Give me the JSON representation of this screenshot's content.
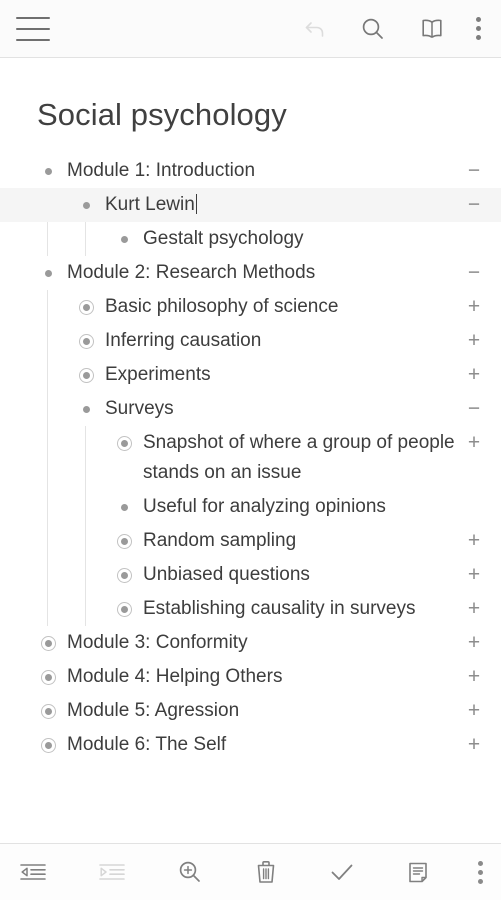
{
  "header": {
    "menu_icon": "hamburger-icon",
    "actions": [
      {
        "name": "undo",
        "icon": "undo-icon",
        "state": "disabled"
      },
      {
        "name": "search",
        "icon": "search-icon",
        "state": "enabled"
      },
      {
        "name": "book",
        "icon": "book-icon",
        "state": "enabled"
      },
      {
        "name": "more",
        "icon": "more-vertical-icon",
        "state": "enabled"
      }
    ]
  },
  "document": {
    "title": "Social psychology"
  },
  "outline": {
    "items": [
      {
        "text": "Module 1: Introduction",
        "level": 0,
        "bullet": "dot",
        "toggle": "−",
        "selected": false,
        "cursor": false
      },
      {
        "text": "Kurt Lewin",
        "level": 1,
        "bullet": "dot",
        "toggle": "−",
        "selected": true,
        "cursor": true
      },
      {
        "text": "Gestalt psychology",
        "level": 2,
        "bullet": "dot",
        "toggle": "",
        "selected": false,
        "cursor": false
      },
      {
        "text": "Module 2: Research Methods",
        "level": 0,
        "bullet": "dot",
        "toggle": "−",
        "selected": false,
        "cursor": false
      },
      {
        "text": "Basic philosophy of science",
        "level": 1,
        "bullet": "ring",
        "toggle": "+",
        "selected": false,
        "cursor": false
      },
      {
        "text": "Inferring causation",
        "level": 1,
        "bullet": "ring",
        "toggle": "+",
        "selected": false,
        "cursor": false
      },
      {
        "text": "Experiments",
        "level": 1,
        "bullet": "ring",
        "toggle": "+",
        "selected": false,
        "cursor": false
      },
      {
        "text": "Surveys",
        "level": 1,
        "bullet": "dot",
        "toggle": "−",
        "selected": false,
        "cursor": false
      },
      {
        "text": "Snapshot of where a group of people stands on an issue",
        "level": 2,
        "bullet": "ring",
        "toggle": "+",
        "selected": false,
        "cursor": false
      },
      {
        "text": "Useful for analyzing opinions",
        "level": 2,
        "bullet": "dot",
        "toggle": "",
        "selected": false,
        "cursor": false
      },
      {
        "text": "Random sampling",
        "level": 2,
        "bullet": "ring",
        "toggle": "+",
        "selected": false,
        "cursor": false
      },
      {
        "text": "Unbiased questions",
        "level": 2,
        "bullet": "ring",
        "toggle": "+",
        "selected": false,
        "cursor": false
      },
      {
        "text": "Establishing causality in surveys",
        "level": 2,
        "bullet": "ring",
        "toggle": "+",
        "selected": false,
        "cursor": false
      },
      {
        "text": "Module 3: Conformity",
        "level": 0,
        "bullet": "ring",
        "toggle": "+",
        "selected": false,
        "cursor": false
      },
      {
        "text": "Module 4: Helping Others",
        "level": 0,
        "bullet": "ring",
        "toggle": "+",
        "selected": false,
        "cursor": false
      },
      {
        "text": "Module 5: Agression",
        "level": 0,
        "bullet": "ring",
        "toggle": "+",
        "selected": false,
        "cursor": false
      },
      {
        "text": "Module 6: The Self",
        "level": 0,
        "bullet": "ring",
        "toggle": "+",
        "selected": false,
        "cursor": false
      }
    ]
  },
  "footer": {
    "actions": [
      {
        "name": "outdent",
        "icon": "outdent-icon",
        "state": "enabled"
      },
      {
        "name": "indent",
        "icon": "indent-icon",
        "state": "disabled"
      },
      {
        "name": "zoom-in",
        "icon": "zoom-in-icon",
        "state": "enabled"
      },
      {
        "name": "delete",
        "icon": "trash-icon",
        "state": "enabled"
      },
      {
        "name": "complete",
        "icon": "check-icon",
        "state": "enabled"
      },
      {
        "name": "note",
        "icon": "note-icon",
        "state": "enabled"
      },
      {
        "name": "more",
        "icon": "more-vertical-icon",
        "state": "enabled"
      }
    ]
  },
  "colors": {
    "text": "#3d3d3d",
    "bullet": "#9a9a9a",
    "ring": "#c2c2c2",
    "toggle": "#8d8d8d",
    "selection": "#f5f5f5",
    "guide": "#e4e4e4",
    "icon": "#6f6f6f",
    "icon_disabled": "#d8d8d8"
  }
}
